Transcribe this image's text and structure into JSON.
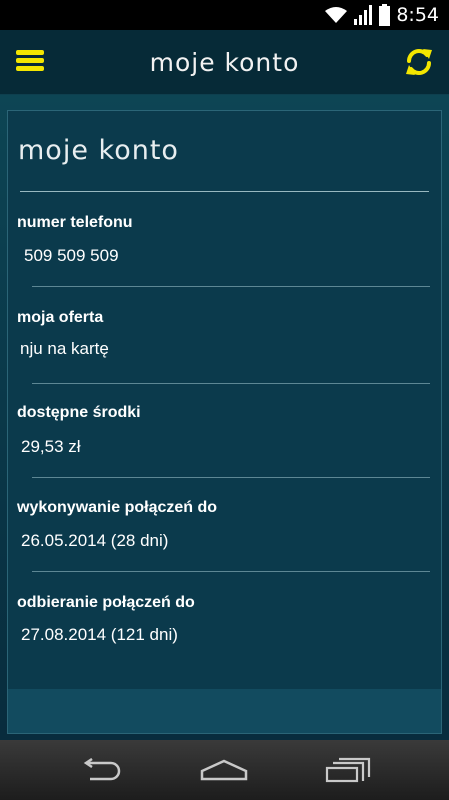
{
  "status_bar": {
    "time": "8:54",
    "icons": [
      "wifi-icon",
      "signal-icon",
      "battery-icon"
    ]
  },
  "header": {
    "title": "moje  konto",
    "menu_icon": "menu-icon",
    "refresh_icon": "refresh-icon",
    "accent_color": "#f3e600"
  },
  "card": {
    "title": "moje  konto",
    "fields": [
      {
        "label": "numer telefonu",
        "value": "509 509 509"
      },
      {
        "label": "moja oferta",
        "value": "nju na kartę"
      },
      {
        "label": "dostępne środki",
        "value": "29,53 zł"
      },
      {
        "label": "wykonywanie połączeń do",
        "value": "26.05.2014 (28 dni)"
      },
      {
        "label": "odbieranie połączeń do",
        "value": "27.08.2014 (121 dni)"
      }
    ]
  },
  "nav_bar": {
    "buttons": [
      "back-icon",
      "home-icon",
      "recent-apps-icon"
    ]
  }
}
